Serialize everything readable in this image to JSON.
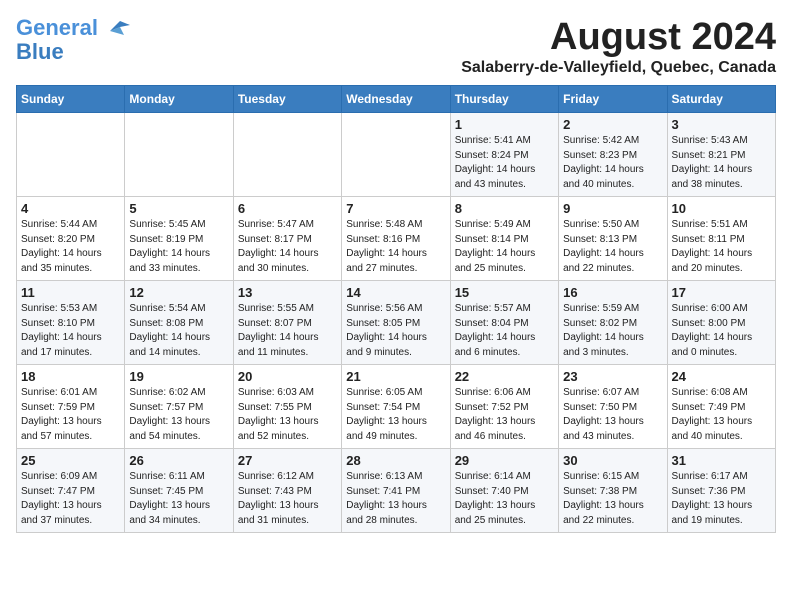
{
  "logo": {
    "line1": "General",
    "line2": "Blue"
  },
  "title": "August 2024",
  "subtitle": "Salaberry-de-Valleyfield, Quebec, Canada",
  "headers": [
    "Sunday",
    "Monday",
    "Tuesday",
    "Wednesday",
    "Thursday",
    "Friday",
    "Saturday"
  ],
  "weeks": [
    [
      {
        "day": "",
        "info": ""
      },
      {
        "day": "",
        "info": ""
      },
      {
        "day": "",
        "info": ""
      },
      {
        "day": "",
        "info": ""
      },
      {
        "day": "1",
        "info": "Sunrise: 5:41 AM\nSunset: 8:24 PM\nDaylight: 14 hours\nand 43 minutes."
      },
      {
        "day": "2",
        "info": "Sunrise: 5:42 AM\nSunset: 8:23 PM\nDaylight: 14 hours\nand 40 minutes."
      },
      {
        "day": "3",
        "info": "Sunrise: 5:43 AM\nSunset: 8:21 PM\nDaylight: 14 hours\nand 38 minutes."
      }
    ],
    [
      {
        "day": "4",
        "info": "Sunrise: 5:44 AM\nSunset: 8:20 PM\nDaylight: 14 hours\nand 35 minutes."
      },
      {
        "day": "5",
        "info": "Sunrise: 5:45 AM\nSunset: 8:19 PM\nDaylight: 14 hours\nand 33 minutes."
      },
      {
        "day": "6",
        "info": "Sunrise: 5:47 AM\nSunset: 8:17 PM\nDaylight: 14 hours\nand 30 minutes."
      },
      {
        "day": "7",
        "info": "Sunrise: 5:48 AM\nSunset: 8:16 PM\nDaylight: 14 hours\nand 27 minutes."
      },
      {
        "day": "8",
        "info": "Sunrise: 5:49 AM\nSunset: 8:14 PM\nDaylight: 14 hours\nand 25 minutes."
      },
      {
        "day": "9",
        "info": "Sunrise: 5:50 AM\nSunset: 8:13 PM\nDaylight: 14 hours\nand 22 minutes."
      },
      {
        "day": "10",
        "info": "Sunrise: 5:51 AM\nSunset: 8:11 PM\nDaylight: 14 hours\nand 20 minutes."
      }
    ],
    [
      {
        "day": "11",
        "info": "Sunrise: 5:53 AM\nSunset: 8:10 PM\nDaylight: 14 hours\nand 17 minutes."
      },
      {
        "day": "12",
        "info": "Sunrise: 5:54 AM\nSunset: 8:08 PM\nDaylight: 14 hours\nand 14 minutes."
      },
      {
        "day": "13",
        "info": "Sunrise: 5:55 AM\nSunset: 8:07 PM\nDaylight: 14 hours\nand 11 minutes."
      },
      {
        "day": "14",
        "info": "Sunrise: 5:56 AM\nSunset: 8:05 PM\nDaylight: 14 hours\nand 9 minutes."
      },
      {
        "day": "15",
        "info": "Sunrise: 5:57 AM\nSunset: 8:04 PM\nDaylight: 14 hours\nand 6 minutes."
      },
      {
        "day": "16",
        "info": "Sunrise: 5:59 AM\nSunset: 8:02 PM\nDaylight: 14 hours\nand 3 minutes."
      },
      {
        "day": "17",
        "info": "Sunrise: 6:00 AM\nSunset: 8:00 PM\nDaylight: 14 hours\nand 0 minutes."
      }
    ],
    [
      {
        "day": "18",
        "info": "Sunrise: 6:01 AM\nSunset: 7:59 PM\nDaylight: 13 hours\nand 57 minutes."
      },
      {
        "day": "19",
        "info": "Sunrise: 6:02 AM\nSunset: 7:57 PM\nDaylight: 13 hours\nand 54 minutes."
      },
      {
        "day": "20",
        "info": "Sunrise: 6:03 AM\nSunset: 7:55 PM\nDaylight: 13 hours\nand 52 minutes."
      },
      {
        "day": "21",
        "info": "Sunrise: 6:05 AM\nSunset: 7:54 PM\nDaylight: 13 hours\nand 49 minutes."
      },
      {
        "day": "22",
        "info": "Sunrise: 6:06 AM\nSunset: 7:52 PM\nDaylight: 13 hours\nand 46 minutes."
      },
      {
        "day": "23",
        "info": "Sunrise: 6:07 AM\nSunset: 7:50 PM\nDaylight: 13 hours\nand 43 minutes."
      },
      {
        "day": "24",
        "info": "Sunrise: 6:08 AM\nSunset: 7:49 PM\nDaylight: 13 hours\nand 40 minutes."
      }
    ],
    [
      {
        "day": "25",
        "info": "Sunrise: 6:09 AM\nSunset: 7:47 PM\nDaylight: 13 hours\nand 37 minutes."
      },
      {
        "day": "26",
        "info": "Sunrise: 6:11 AM\nSunset: 7:45 PM\nDaylight: 13 hours\nand 34 minutes."
      },
      {
        "day": "27",
        "info": "Sunrise: 6:12 AM\nSunset: 7:43 PM\nDaylight: 13 hours\nand 31 minutes."
      },
      {
        "day": "28",
        "info": "Sunrise: 6:13 AM\nSunset: 7:41 PM\nDaylight: 13 hours\nand 28 minutes."
      },
      {
        "day": "29",
        "info": "Sunrise: 6:14 AM\nSunset: 7:40 PM\nDaylight: 13 hours\nand 25 minutes."
      },
      {
        "day": "30",
        "info": "Sunrise: 6:15 AM\nSunset: 7:38 PM\nDaylight: 13 hours\nand 22 minutes."
      },
      {
        "day": "31",
        "info": "Sunrise: 6:17 AM\nSunset: 7:36 PM\nDaylight: 13 hours\nand 19 minutes."
      }
    ]
  ]
}
